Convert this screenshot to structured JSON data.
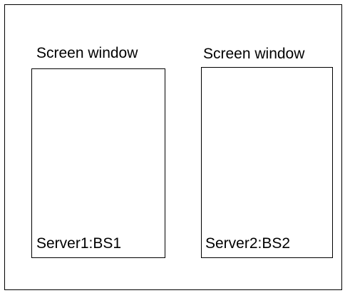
{
  "windows": [
    {
      "title": "Screen window",
      "server_label": "Server1:BS1"
    },
    {
      "title": "Screen window",
      "server_label": "Server2:BS2"
    }
  ],
  "colors": {
    "background": "#ffffff",
    "stroke": "#000000",
    "text": "#000000"
  }
}
